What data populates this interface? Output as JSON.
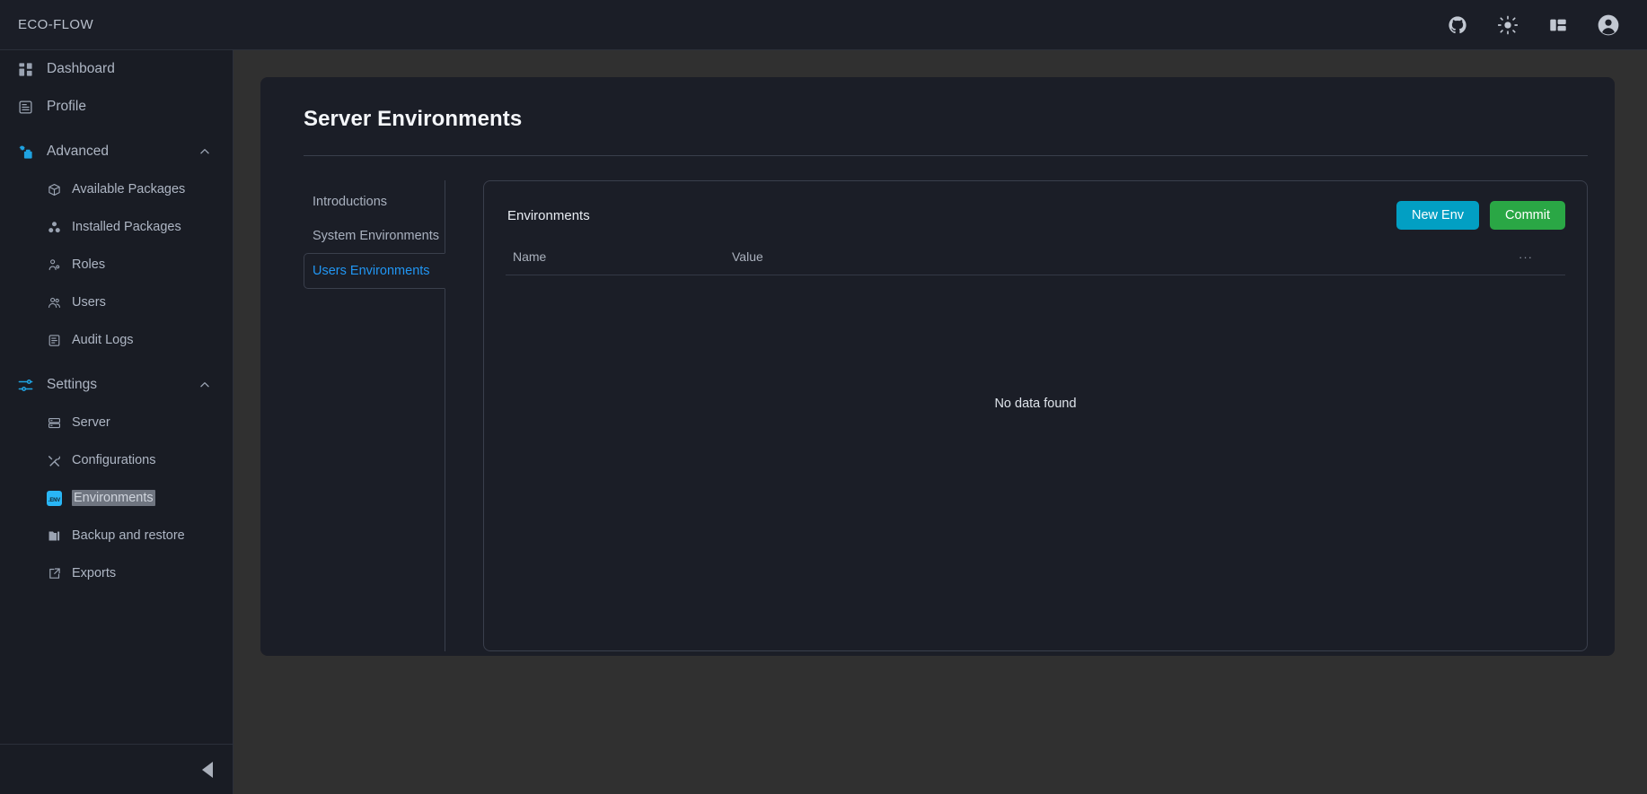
{
  "topbar": {
    "brand": "ECO-FLOW",
    "icons": [
      {
        "name": "github-icon",
        "label": "GitHub"
      },
      {
        "name": "sun-icon",
        "label": "Light mode"
      },
      {
        "name": "panel-layout-icon",
        "label": "Toggle layout"
      },
      {
        "name": "account-avatar-icon",
        "label": "Account"
      }
    ]
  },
  "sidebar": {
    "items": [
      {
        "label": "Dashboard",
        "icon": "dashboard-grid-icon",
        "type": "item"
      },
      {
        "label": "Profile",
        "icon": "profile-card-icon",
        "type": "item"
      },
      {
        "label": "Advanced",
        "icon": "advanced-gear-icon",
        "type": "group",
        "expanded": true,
        "chevron": "chevron-up-icon"
      },
      {
        "label": "Available Packages",
        "icon": "package-search-icon",
        "type": "child"
      },
      {
        "label": "Installed Packages",
        "icon": "packages-stack-icon",
        "type": "child"
      },
      {
        "label": "Roles",
        "icon": "role-user-icon",
        "type": "child"
      },
      {
        "label": "Users",
        "icon": "users-icon",
        "type": "child"
      },
      {
        "label": "Audit Logs",
        "icon": "audit-log-icon",
        "type": "child"
      },
      {
        "label": "Settings",
        "icon": "settings-sliders-icon",
        "type": "group",
        "expanded": true,
        "chevron": "chevron-up-icon"
      },
      {
        "label": "Server",
        "icon": "server-rack-icon",
        "type": "child"
      },
      {
        "label": "Configurations",
        "icon": "wrench-screwdriver-icon",
        "type": "child"
      },
      {
        "label": "Environments",
        "icon": "env-file-icon",
        "icon_text": ".ENV",
        "type": "child",
        "selected": true
      },
      {
        "label": "Backup and restore",
        "icon": "backup-folder-icon",
        "type": "child"
      },
      {
        "label": "Exports",
        "icon": "export-share-icon",
        "type": "child"
      }
    ],
    "collapse": {
      "label": "Collapse sidebar",
      "icon": "triangle-left-icon"
    }
  },
  "page": {
    "title": "Server Environments",
    "tabs": [
      {
        "label": "Introductions",
        "active": false
      },
      {
        "label": "System Environments",
        "active": false
      },
      {
        "label": "Users Environments",
        "active": true
      }
    ]
  },
  "env_panel": {
    "title": "Environments",
    "new_button": "New Env",
    "commit_button": "Commit",
    "columns": {
      "name": "Name",
      "value": "Value",
      "more": "···"
    },
    "rows": [],
    "empty_message": "No data found"
  },
  "colors": {
    "page_background": "#303030",
    "card_background": "#1b1e27",
    "sidebar_background": "#191c24",
    "accent_blue": "#2196f3",
    "new_env_button": "#029fc3",
    "commit_button": "#2aa745",
    "env_badge": "#29b6f6",
    "border": "#3a3f4c"
  }
}
